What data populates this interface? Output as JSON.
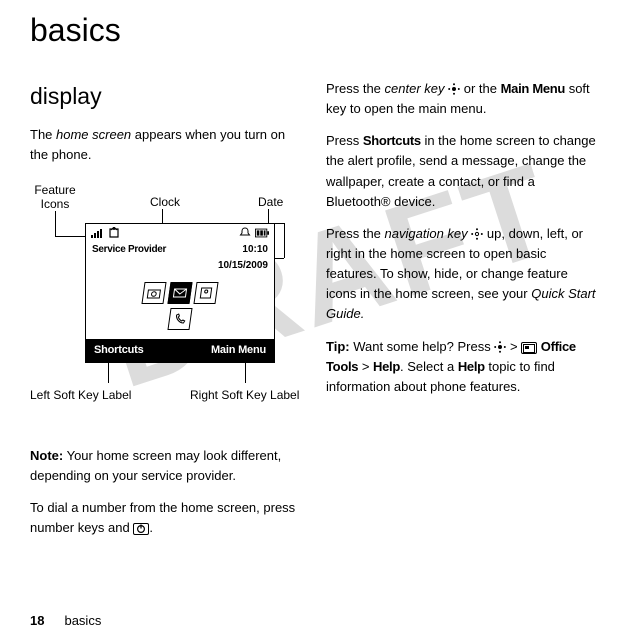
{
  "page": {
    "title": "basics",
    "footer_section": "basics",
    "page_number": "18",
    "watermark": "DRAFT"
  },
  "left": {
    "heading": "display",
    "p1_a": "The ",
    "p1_em": "home screen",
    "p1_b": " appears when you turn on the phone.",
    "note_label": "Note:",
    "note_body": " Your home screen may look different, depending on your service provider.",
    "p3": "To dial a number from the home screen, press number keys and "
  },
  "diagram": {
    "feature_icons": "Feature\nIcons",
    "clock": "Clock",
    "date": "Date",
    "left_soft": "Left Soft Key Label",
    "right_soft": "Right Soft Key Label",
    "provider": "Service Provider",
    "time": "10:10",
    "date_value": "10/15/2009",
    "sk_left": "Shortcuts",
    "sk_right": "Main Menu"
  },
  "right": {
    "p1_a": "Press the ",
    "p1_em": "center key",
    "p1_b": " ",
    "p1_c": " or the ",
    "p1_bold": "Main Menu",
    "p1_d": " soft key to open the main menu.",
    "p2_a": "Press ",
    "p2_bold": "Shortcuts",
    "p2_b": " in the home screen to change the alert profile, send a message, change the wallpaper, create a contact, or find a Bluetooth® device.",
    "p3_a": "Press the ",
    "p3_em": "navigation key",
    "p3_b": " up, down, left, or right in the home screen to open basic features. To show, hide, or change feature icons in the home screen, see your ",
    "p3_em2": "Quick Start Guide.",
    "tip_label": "Tip:",
    "tip_a": " Want some help? Press ",
    "tip_bold1": "Office Tools",
    "tip_sep": " > ",
    "tip_bold2": "Help",
    "tip_b": ". Select a ",
    "tip_bold3": "Help",
    "tip_c": " topic to find information about phone features."
  }
}
